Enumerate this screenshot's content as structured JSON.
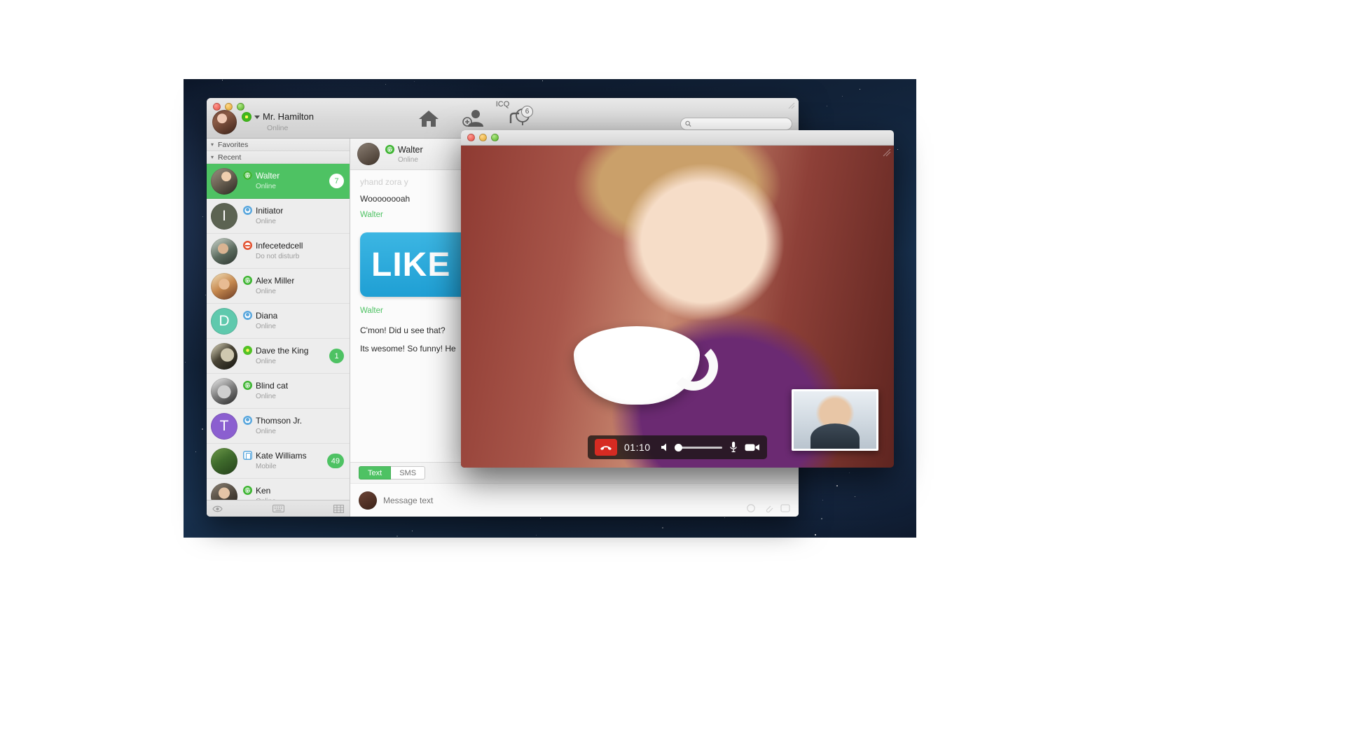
{
  "window": {
    "title": "ICQ",
    "account": {
      "name": "Mr. Hamilton",
      "status": "Online",
      "status_icon": "flower-green-icon"
    },
    "toolbar": [
      {
        "name": "home-icon",
        "label": "Home"
      },
      {
        "name": "add-contact-icon",
        "label": "Add contact"
      },
      {
        "name": "chats-icon",
        "label": "Chats",
        "badge": "6"
      }
    ],
    "search": {
      "placeholder": "",
      "value": "",
      "icon": "search-icon"
    }
  },
  "sidebar": {
    "groups": [
      {
        "label": "Favorites",
        "expanded": true
      },
      {
        "label": "Recent",
        "expanded": true
      }
    ],
    "contacts": [
      {
        "name": "Walter",
        "status": "Online",
        "status_icon": "icq-green-icon",
        "badge": "7",
        "selected": true,
        "avatar": "photo-man-headphones"
      },
      {
        "name": "Initiator",
        "status": "Online",
        "status_icon": "blue-person-icon",
        "badge": "",
        "selected": false,
        "avatar": "letter-I",
        "initial": "I",
        "avatar_color": "#5c6352"
      },
      {
        "name": "Infecetedcell",
        "status": "Do not disturb",
        "status_icon": "dnd-red-icon",
        "badge": "",
        "selected": false,
        "avatar": "photo-man-hood"
      },
      {
        "name": "Alex Miller",
        "status": "Online",
        "status_icon": "icq-green-icon",
        "badge": "",
        "selected": false,
        "avatar": "photo-man-sunglasses"
      },
      {
        "name": "Diana",
        "status": "Online",
        "status_icon": "blue-person-icon",
        "badge": "",
        "selected": false,
        "avatar": "letter-D",
        "initial": "D",
        "avatar_color": "#5fc9ad"
      },
      {
        "name": "Dave the King",
        "status": "Online",
        "status_icon": "flower-green-icon",
        "badge": "1",
        "selected": false,
        "avatar": "photo-art-face"
      },
      {
        "name": "Blind cat",
        "status": "Online",
        "status_icon": "icq-green-icon",
        "badge": "",
        "selected": false,
        "avatar": "photo-cat-sunglasses"
      },
      {
        "name": "Thomson Jr.",
        "status": "Online",
        "status_icon": "blue-person-icon",
        "badge": "",
        "selected": false,
        "avatar": "letter-T",
        "initial": "T",
        "avatar_color": "#8b5fd0"
      },
      {
        "name": "Kate Williams",
        "status": "Mobile",
        "status_icon": "mobile-blue-icon",
        "badge": "49",
        "selected": false,
        "avatar": "photo-minecraft"
      },
      {
        "name": "Ken",
        "status": "Online",
        "status_icon": "icq-green-icon",
        "badge": "",
        "selected": false,
        "avatar": "photo-person"
      }
    ],
    "footer_icons": [
      "eye-icon",
      "keyboard-icon",
      "grid-icon"
    ]
  },
  "chat": {
    "header": {
      "name": "Walter",
      "status": "Online",
      "status_icon": "icq-green-icon"
    },
    "messages": [
      {
        "type": "faded",
        "text": "yhand zora  y"
      },
      {
        "type": "text",
        "text": "Woooooooah"
      },
      {
        "type": "sender",
        "text": "Walter"
      },
      {
        "type": "image",
        "text": "LIKE"
      },
      {
        "type": "sender",
        "text": "Walter"
      },
      {
        "type": "text",
        "text": "C'mon! Did u see that?"
      },
      {
        "type": "text",
        "text": "Its wesome! So funny! He"
      }
    ],
    "tabs": [
      {
        "label": "Text",
        "active": true
      },
      {
        "label": "SMS",
        "active": false
      }
    ],
    "compose": {
      "placeholder": "Message text",
      "value": ""
    }
  },
  "video_call": {
    "timer": "01:10",
    "controls": [
      {
        "name": "hangup-button",
        "icon": "phone-hangup-icon"
      },
      {
        "name": "call-timer",
        "icon": ""
      },
      {
        "name": "speaker-volume",
        "icon": "speaker-icon"
      },
      {
        "name": "microphone-button",
        "icon": "microphone-icon"
      },
      {
        "name": "camera-button",
        "icon": "video-camera-icon"
      }
    ],
    "volume_percent": 10
  },
  "colors": {
    "accent_green": "#4ec263",
    "hangup_red": "#d62b22",
    "like_blue": "#1f9fd4"
  }
}
